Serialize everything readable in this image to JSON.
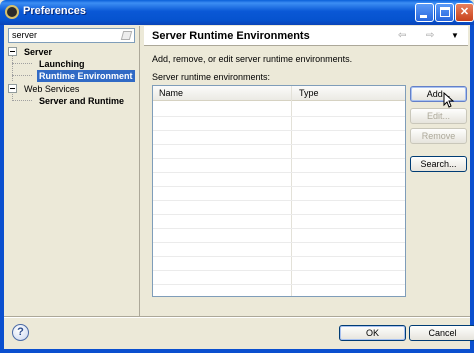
{
  "window": {
    "title": "Preferences"
  },
  "filter": {
    "value": "server"
  },
  "tree": {
    "items": [
      {
        "label": "Server"
      },
      {
        "label": "Launching"
      },
      {
        "label": "Runtime Environment"
      },
      {
        "label": "Web Services"
      },
      {
        "label": "Server and Runtime"
      }
    ]
  },
  "page": {
    "title": "Server Runtime Environments",
    "description": "Add, remove, or edit server runtime environments.",
    "list_label": "Server runtime environments:",
    "columns": [
      "Name",
      "Type"
    ]
  },
  "buttons": {
    "add": "Add...",
    "edit": "Edit...",
    "remove": "Remove",
    "search": "Search...",
    "ok": "OK",
    "cancel": "Cancel",
    "help": "?"
  },
  "icons": {
    "back": "back-arrow-icon",
    "forward": "forward-arrow-icon",
    "view_menu": "view-menu-icon",
    "help": "help-icon",
    "clear": "clear-filter-icon"
  },
  "colors": {
    "titlebar": "#0a58d6",
    "selection": "#316ac5",
    "dialog_bg": "#ece9d8"
  }
}
